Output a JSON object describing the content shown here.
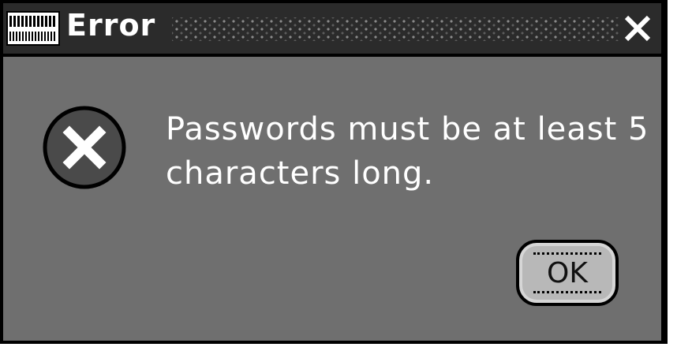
{
  "window": {
    "title": "Error",
    "logo_icon": "application-logo-icon",
    "close_icon": "close-icon"
  },
  "dialog": {
    "icon": "error-x-icon",
    "message_line1": "Passwords must be at least 5",
    "message_line2": "characters long.",
    "ok_label": "OK"
  },
  "colors": {
    "background": "#6f6f6f",
    "titlebar": "#2b2b2b",
    "button": "#b8b8b8",
    "text": "#ffffff"
  }
}
